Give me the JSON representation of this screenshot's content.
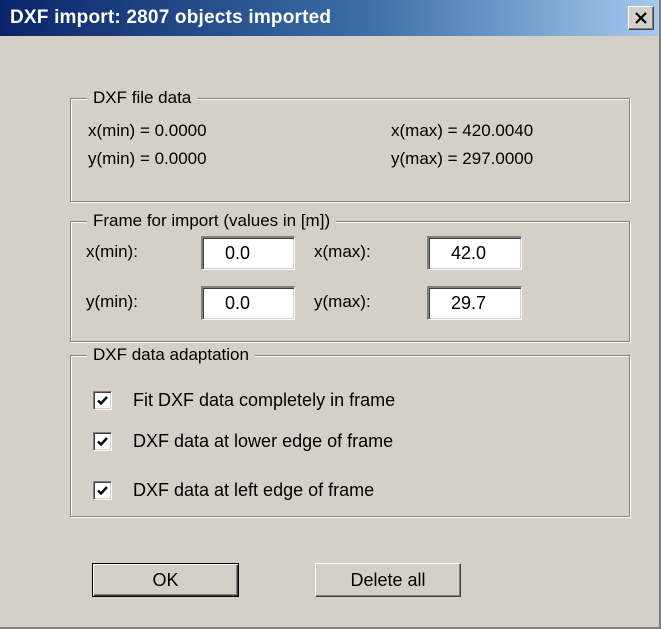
{
  "window": {
    "title": "DXF import: 2807 objects imported",
    "close_icon": "close-icon"
  },
  "file_data": {
    "legend": "DXF file data",
    "xmin": "x(min) = 0.0000",
    "xmax": "x(max) = 420.0040",
    "ymin": "y(min) = 0.0000",
    "ymax": "y(max) = 297.0000"
  },
  "frame": {
    "legend": "Frame for import (values in [m])",
    "xmin_label": "x(min):",
    "xmin_value": "0.0",
    "xmax_label": "x(max):",
    "xmax_value": "42.0",
    "ymin_label": "y(min):",
    "ymin_value": "0.0",
    "ymax_label": "y(max):",
    "ymax_value": "29.7"
  },
  "adaptation": {
    "legend": "DXF data adaptation",
    "options": [
      {
        "label": "Fit DXF data completely in frame",
        "checked": true
      },
      {
        "label": "DXF data at lower edge of frame",
        "checked": true
      },
      {
        "label": "DXF data at left edge of frame",
        "checked": true
      }
    ]
  },
  "buttons": {
    "ok": "OK",
    "delete_all": "Delete all"
  }
}
